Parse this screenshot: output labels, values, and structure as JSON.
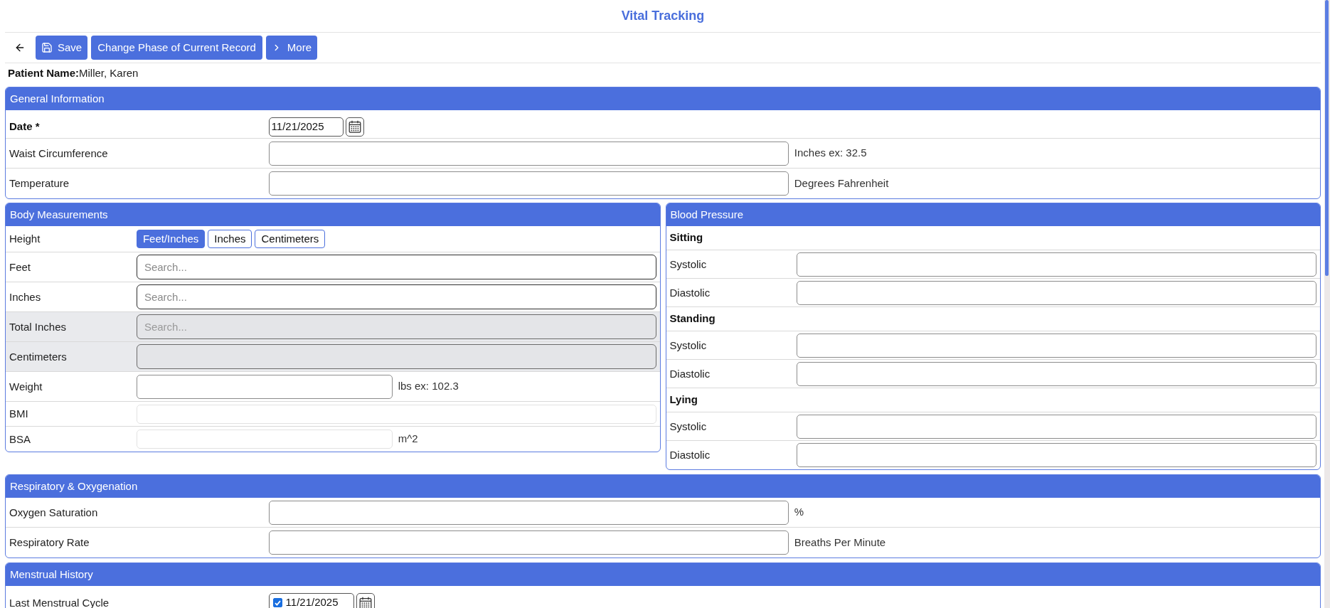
{
  "page": {
    "title": "Vital Tracking"
  },
  "toolbar": [
    {
      "kind": "back"
    },
    {
      "kind": "save",
      "label": "Save"
    },
    {
      "kind": "plain",
      "label": "Change Phase of Current Record"
    },
    {
      "kind": "more",
      "label": "More"
    }
  ],
  "patient": {
    "label": "Patient Name:",
    "value": "Miller, Karen"
  },
  "general_information": {
    "title": "General Information",
    "rows": [
      {
        "kind": "date",
        "label": "Date *",
        "required": true,
        "value": "11/21/2025"
      },
      {
        "kind": "input",
        "label": "Waist Circumference",
        "required": false,
        "hint": "Inches ex: 32.5"
      },
      {
        "kind": "input",
        "label": "Temperature",
        "required": false,
        "hint": "Degrees Fahrenheit"
      }
    ]
  },
  "body_measurements": {
    "title": "Body Measurements",
    "rows": [
      {
        "kind": "units",
        "label": "Height",
        "options": [
          {
            "label": "Feet/Inches",
            "selected": true
          },
          {
            "label": "Inches",
            "selected": false
          },
          {
            "label": "Centimeters",
            "selected": false
          }
        ]
      },
      {
        "kind": "lookup",
        "label": "Feet",
        "placeholder": "Search...",
        "disabled": false
      },
      {
        "kind": "lookup",
        "label": "Inches",
        "placeholder": "Search...",
        "disabled": false
      },
      {
        "kind": "lookup",
        "label": "Total Inches",
        "placeholder": "Search...",
        "disabled": true
      },
      {
        "kind": "lookup",
        "label": "Centimeters",
        "disabled": true
      },
      {
        "kind": "input",
        "label": "Weight",
        "hint": "lbs ex: 102.3",
        "readonly": false
      },
      {
        "kind": "input",
        "label": "BMI",
        "readonly": true
      },
      {
        "kind": "input",
        "label": "BSA",
        "hint": "m^2",
        "readonly": true
      }
    ]
  },
  "blood_pressure": {
    "title": "Blood Pressure",
    "positions": [
      {
        "heading": "Sitting",
        "fields": [
          {
            "label": "Systolic"
          },
          {
            "label": "Diastolic"
          }
        ]
      },
      {
        "heading": "Standing",
        "fields": [
          {
            "label": "Systolic"
          },
          {
            "label": "Diastolic"
          }
        ]
      },
      {
        "heading": "Lying",
        "fields": [
          {
            "label": "Systolic"
          },
          {
            "label": "Diastolic"
          }
        ]
      }
    ]
  },
  "respiratory_oxygenation": {
    "title": "Respiratory & Oxygenation",
    "rows": [
      {
        "kind": "input",
        "label": "Oxygen Saturation",
        "hint": "%"
      },
      {
        "kind": "input",
        "label": "Respiratory Rate",
        "hint": "Breaths Per Minute"
      }
    ]
  },
  "menstrual_history": {
    "title": "Menstrual History",
    "rows": [
      {
        "kind": "date",
        "label": "Last Menstrual Cycle",
        "required": false,
        "value": "11/21/2025",
        "checked": true
      }
    ]
  }
}
